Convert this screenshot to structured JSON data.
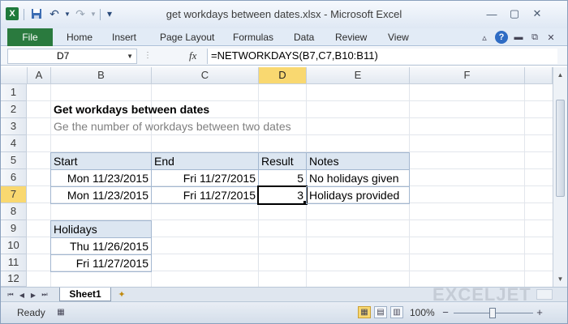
{
  "window": {
    "title": "get workdays between dates.xlsx - Microsoft Excel",
    "logo_letter": "X",
    "controls": {
      "minimize": "—",
      "maximize": "▢",
      "close": "✕"
    },
    "ribbon_controls": {
      "minimize": "▵",
      "help": "?",
      "restore": "⧉",
      "close": "✕"
    }
  },
  "ribbon": {
    "file_label": "File",
    "tabs": [
      "Home",
      "Insert",
      "Page Layout",
      "Formulas",
      "Data",
      "Review",
      "View"
    ]
  },
  "formula_bar": {
    "name_box": "D7",
    "fx_label": "fx",
    "formula": "=NETWORKDAYS(B7,C7,B10:B11)"
  },
  "grid": {
    "columns": [
      "A",
      "B",
      "C",
      "D",
      "E",
      "F"
    ],
    "selected_column": "D",
    "rows": [
      "1",
      "2",
      "3",
      "4",
      "5",
      "6",
      "7",
      "8",
      "9",
      "10",
      "11",
      "12"
    ],
    "selected_row": "7"
  },
  "content": {
    "title": "Get workdays between dates",
    "subtitle": "Ge the number of workdays between two dates",
    "table": {
      "headers": [
        "Start",
        "End",
        "Result",
        "Notes"
      ],
      "rows": [
        [
          "Mon 11/23/2015",
          "Fri 11/27/2015",
          "5",
          "No holidays given"
        ],
        [
          "Mon 11/23/2015",
          "Fri 11/27/2015",
          "3",
          "Holidays provided"
        ]
      ]
    },
    "holidays": {
      "header": "Holidays",
      "values": [
        "Thu 11/26/2015",
        "Fri 11/27/2015"
      ]
    }
  },
  "sheets": {
    "tabs": [
      "Sheet1"
    ],
    "active": "Sheet1",
    "watermark": "EXCELJET"
  },
  "status": {
    "text": "Ready",
    "zoom": "100%",
    "zoom_minus": "−",
    "zoom_plus": "+"
  }
}
